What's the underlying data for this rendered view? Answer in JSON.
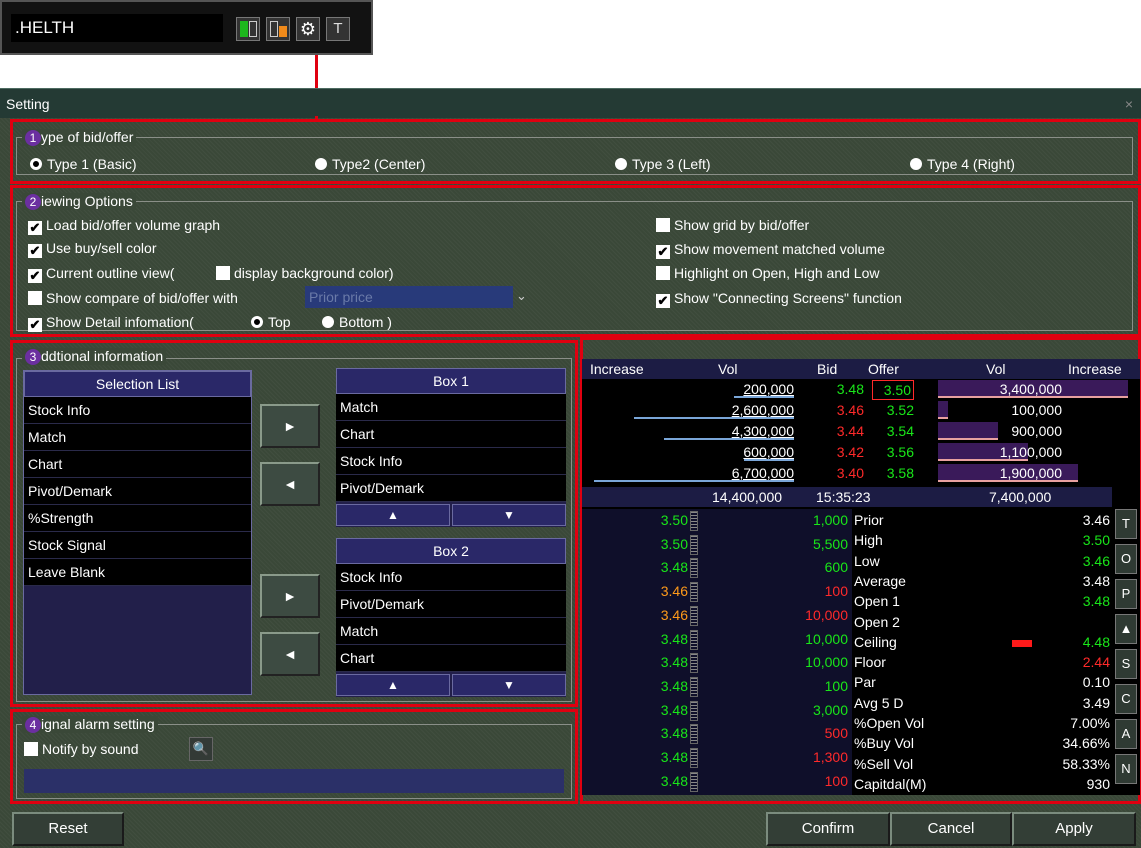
{
  "topbar": {
    "symbol": ".HELTH",
    "t_label": "T"
  },
  "window": {
    "title": "Setting",
    "close": "×"
  },
  "g1": {
    "num": "1",
    "legend": "ype of bid/offer",
    "types": [
      "Type 1 (Basic)",
      "Type2 (Center)",
      "Type 3 (Left)",
      "Type 4 (Right)"
    ]
  },
  "g2": {
    "num": "2",
    "legend": "iewing Options",
    "left": [
      "Load bid/offer volume graph",
      "Use buy/sell color",
      "Current outline view(",
      "Show compare of bid/offer with",
      "Show Detail infomation("
    ],
    "display_bg": "display background color)",
    "prior_price": "Prior price",
    "top": "Top",
    "bottom": "Bottom )",
    "right": [
      "Show grid by bid/offer",
      "Show movement matched volume",
      "Highlight on Open, High and Low",
      "Show \"Connecting Screens\" function"
    ]
  },
  "g3": {
    "num": "3",
    "legend": "ddtional information",
    "selection_header": "Selection List",
    "selection": [
      "Stock Info",
      "Match",
      "Chart",
      "Pivot/Demark",
      "%Strength",
      "Stock Signal",
      "Leave Blank"
    ],
    "box1_header": "Box 1",
    "box1": [
      "Match",
      "Chart",
      "Stock Info",
      "Pivot/Demark"
    ],
    "box2_header": "Box 2",
    "box2": [
      "Stock Info",
      "Pivot/Demark",
      "Match",
      "Chart"
    ],
    "right_arrow": "►",
    "left_arrow": "◄",
    "up": "▲",
    "down": "▼"
  },
  "g4": {
    "num": "4",
    "legend": "ignal alarm setting",
    "notify": "Notify by sound"
  },
  "preview": {
    "headers": [
      "Increase",
      "Vol",
      "Bid",
      "Offer",
      "Vol",
      "Increase"
    ],
    "rows": [
      {
        "bvol": "200,000",
        "bid": "3.48",
        "offer": "3.50",
        "ovol": "3,400,000",
        "bcls": "g",
        "ocls": "g"
      },
      {
        "bvol": "2,600,000",
        "bid": "3.46",
        "offer": "3.52",
        "ovol": "100,000",
        "bcls": "r",
        "ocls": "g"
      },
      {
        "bvol": "4,300,000",
        "bid": "3.44",
        "offer": "3.54",
        "ovol": "900,000",
        "bcls": "r",
        "ocls": "g"
      },
      {
        "bvol": "600,000",
        "bid": "3.42",
        "offer": "3.56",
        "ovol": "1,100,000",
        "bcls": "r",
        "ocls": "g"
      },
      {
        "bvol": "6,700,000",
        "bid": "3.40",
        "offer": "3.58",
        "ovol": "1,900,000",
        "bcls": "r",
        "ocls": "g"
      }
    ],
    "total_bid": "14,400,000",
    "time": "15:35:23",
    "total_offer": "7,400,000",
    "ticks": [
      {
        "p": "3.50",
        "v": "1,000",
        "pc": "g",
        "vc": "g"
      },
      {
        "p": "3.50",
        "v": "5,500",
        "pc": "g",
        "vc": "g"
      },
      {
        "p": "3.48",
        "v": "600",
        "pc": "g",
        "vc": "g"
      },
      {
        "p": "3.46",
        "v": "100",
        "pc": "o",
        "vc": "r"
      },
      {
        "p": "3.46",
        "v": "10,000",
        "pc": "o",
        "vc": "r"
      },
      {
        "p": "3.48",
        "v": "10,000",
        "pc": "g",
        "vc": "g"
      },
      {
        "p": "3.48",
        "v": "10,000",
        "pc": "g",
        "vc": "g"
      },
      {
        "p": "3.48",
        "v": "100",
        "pc": "g",
        "vc": "g"
      },
      {
        "p": "3.48",
        "v": "3,000",
        "pc": "g",
        "vc": "g"
      },
      {
        "p": "3.48",
        "v": "500",
        "pc": "g",
        "vc": "r"
      },
      {
        "p": "3.48",
        "v": "1,300",
        "pc": "g",
        "vc": "r"
      },
      {
        "p": "3.48",
        "v": "100",
        "pc": "g",
        "vc": "r"
      }
    ],
    "stats": [
      {
        "l": "Prior",
        "v": "3.46",
        "c": "w"
      },
      {
        "l": "High",
        "v": "3.50",
        "c": "g"
      },
      {
        "l": "Low",
        "v": "3.46",
        "c": "g"
      },
      {
        "l": "Average",
        "v": "3.48",
        "c": "w"
      },
      {
        "l": "Open 1",
        "v": "3.48",
        "c": "g"
      },
      {
        "l": "Open 2",
        "v": "",
        "c": "w"
      },
      {
        "l": "Ceiling",
        "v": "4.48",
        "c": "g"
      },
      {
        "l": "Floor",
        "v": "2.44",
        "c": "r"
      },
      {
        "l": "Par",
        "v": "0.10",
        "c": "w"
      },
      {
        "l": "Avg 5 D",
        "v": "3.49",
        "c": "w"
      },
      {
        "l": "%Open Vol",
        "v": "7.00%",
        "c": "w"
      },
      {
        "l": "%Buy Vol",
        "v": "34.66%",
        "c": "w"
      },
      {
        "l": "%Sell Vol",
        "v": "58.33%",
        "c": "w"
      },
      {
        "l": "Capitdal(M)",
        "v": "930",
        "c": "w"
      }
    ],
    "side": [
      "T",
      "O",
      "P",
      "▲",
      "S",
      "C",
      "A",
      "N"
    ]
  },
  "buttons": {
    "reset": "Reset",
    "confirm": "Confirm",
    "cancel": "Cancel",
    "apply": "Apply"
  }
}
